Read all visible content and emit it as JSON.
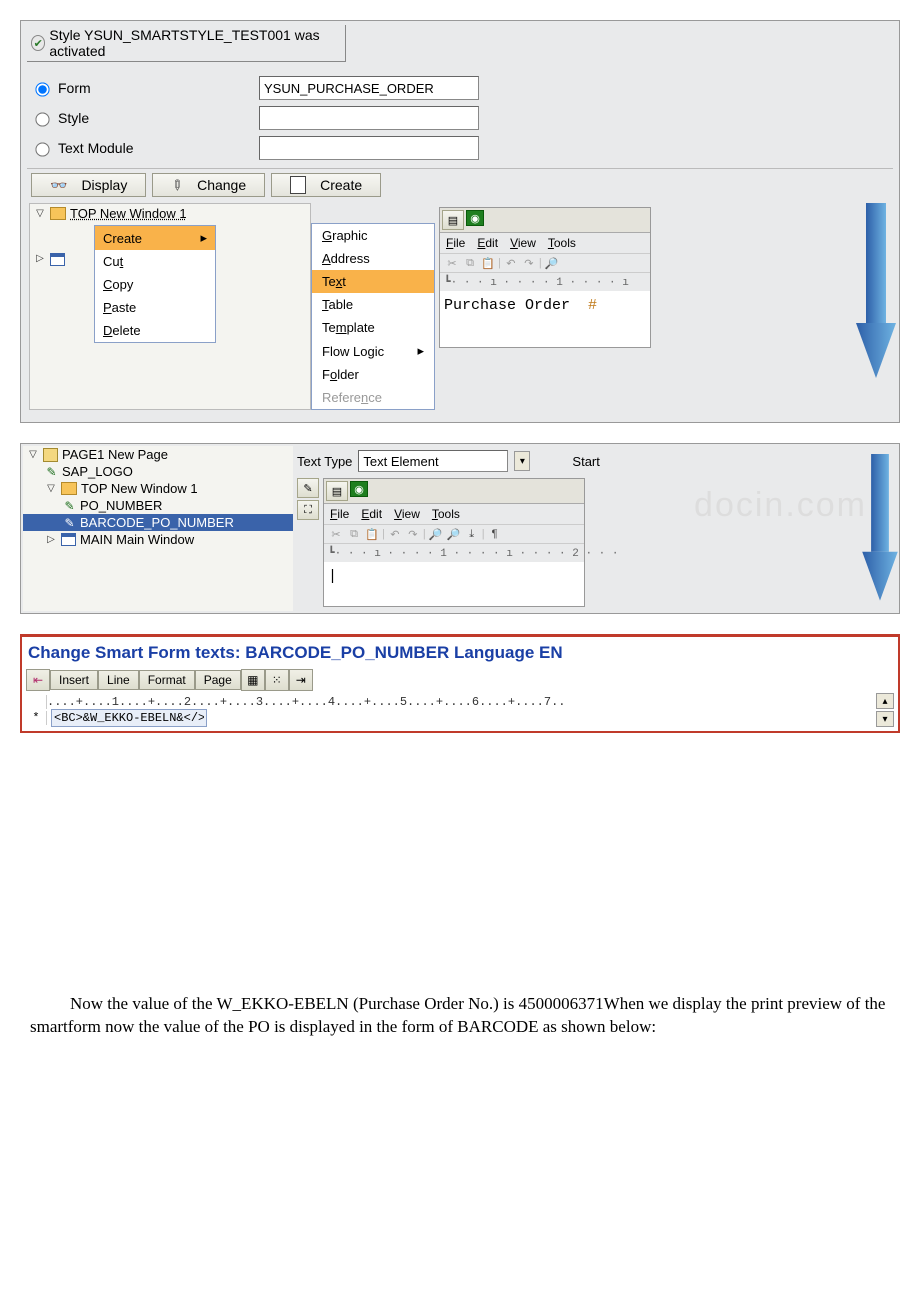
{
  "status_text": "Style YSUN_SMARTSTYLE_TEST001 was activated",
  "radio": {
    "form": "Form",
    "style": "Style",
    "text_module": "Text Module",
    "form_value": "YSUN_PURCHASE_ORDER"
  },
  "buttons": {
    "display": "Display",
    "change": "Change",
    "create": "Create"
  },
  "tree_header": "TOP New Window 1",
  "context_menu": {
    "create": "Create",
    "cut": "Cut",
    "copy": "Copy",
    "paste": "Paste",
    "delete": "Delete"
  },
  "submenu": {
    "graphic": "Graphic",
    "address": "Address",
    "text": "Text",
    "table": "Table",
    "template": "Template",
    "flow_logic": "Flow Logic",
    "folder": "Folder",
    "reference": "Reference"
  },
  "mini_editor": {
    "file": "File",
    "edit": "Edit",
    "view": "View",
    "tools": "Tools",
    "ruler": "· · · ı · · · · 1 · · · · ı",
    "content": "Purchase Order"
  },
  "panel2": {
    "tree": {
      "page1": "PAGE1 New Page",
      "sap_logo": "SAP_LOGO",
      "top_window": "TOP New Window 1",
      "po_number": "PO_NUMBER",
      "barcode_po_number": "BARCODE_PO_NUMBER",
      "main_window": "MAIN Main Window"
    },
    "text_type_label": "Text Type",
    "text_element_value": "Text Element",
    "start_label": "Start",
    "mini_editor2": {
      "file": "File",
      "edit": "Edit",
      "view": "View",
      "tools": "Tools",
      "ruler": "· · · ı · · · · 1 · · · · ı · · · · 2 · · ·"
    }
  },
  "panel3": {
    "title": "Change Smart Form texts: BARCODE_PO_NUMBER Language EN",
    "btns": {
      "insert": "Insert",
      "line": "Line",
      "format": "Format",
      "page": "Page"
    },
    "ruler": "....+....1....+....2....+....3....+....4....+....5....+....6....+....7..",
    "row_prefix": "*",
    "code": "<BC>&W_EKKO-EBELN&</>"
  },
  "body_paragraph": "Now the value of the W_EKKO-EBELN (Purchase Order No.) is 4500006371When we display the print preview of the smartform now the value of the PO is displayed in the form of BARCODE as shown below:",
  "watermark": "docin.com"
}
